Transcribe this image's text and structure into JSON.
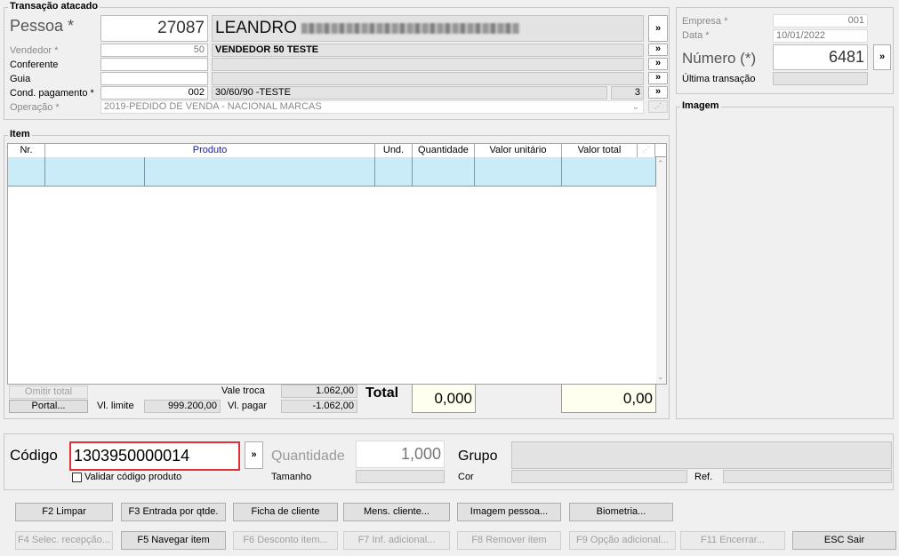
{
  "transacao": {
    "title": "Transação atacado",
    "pessoa": {
      "label": "Pessoa *",
      "code": "27087",
      "name": "LEANDRO"
    },
    "vendedor": {
      "label": "Vendedor *",
      "code": "50",
      "name": "VENDEDOR 50 TESTE"
    },
    "conferente": {
      "label": "Conferente",
      "code": "",
      "name": ""
    },
    "guia": {
      "label": "Guia",
      "code": "",
      "name": ""
    },
    "cond_pagamento": {
      "label": "Cond. pagamento *",
      "code": "002",
      "name": "30/60/90 -TESTE",
      "parcelas": "3"
    },
    "operacao": {
      "label": "Operação *",
      "value": "2019-PEDIDO DE VENDA - NACIONAL MARCAS"
    }
  },
  "lookup_label": "»",
  "header_right": {
    "empresa": {
      "label": "Empresa *",
      "value": "001"
    },
    "data": {
      "label": "Data *",
      "value": "10/01/2022"
    },
    "numero": {
      "label": "Número (*)",
      "value": "6481"
    },
    "ultima": {
      "label": "Última transação",
      "value": ""
    }
  },
  "imagem": {
    "title": "Imagem"
  },
  "item": {
    "title": "Item",
    "columns": [
      "Nr.",
      "Produto",
      "Und.",
      "Quantidade",
      "Valor unitário",
      "Valor total"
    ],
    "rows": [
      [
        "",
        "",
        "",
        "",
        "",
        "",
        ""
      ]
    ]
  },
  "totals": {
    "omitir_total": "Omitir total",
    "portal": "Portal...",
    "vl_limite_label": "Vl. limite",
    "vl_limite": "999.200,00",
    "vale_troca_label": "Vale troca",
    "vale_troca": "1.062,00",
    "vl_pagar_label": "Vl. pagar",
    "vl_pagar": "-1.062,00",
    "total_label": "Total",
    "total_qty": "0,000",
    "total_value": "0,00"
  },
  "entry": {
    "codigo_label": "Código",
    "codigo_value": "1303950000014",
    "validar_label": "Validar código produto",
    "quantidade_label": "Quantidade",
    "quantidade_value": "1,000",
    "tamanho_label": "Tamanho",
    "grupo_label": "Grupo",
    "cor_label": "Cor",
    "ref_label": "Ref."
  },
  "buttons_row1": [
    "F2 Limpar",
    "F3 Entrada por qtde.",
    "Ficha de cliente",
    "Mens. cliente...",
    "Imagem pessoa...",
    "Biometria..."
  ],
  "buttons_row2": [
    {
      "label": "F4 Selec. recepção...",
      "enabled": false
    },
    {
      "label": "F5 Navegar item",
      "enabled": true
    },
    {
      "label": "F6 Desconto item...",
      "enabled": false
    },
    {
      "label": "F7 Inf. adicional...",
      "enabled": false
    },
    {
      "label": "F8 Remover item",
      "enabled": false
    },
    {
      "label": "F9 Opção adicional...",
      "enabled": false
    },
    {
      "label": "F11 Encerrar...",
      "enabled": false
    },
    {
      "label": "ESC Sair",
      "enabled": true
    }
  ]
}
